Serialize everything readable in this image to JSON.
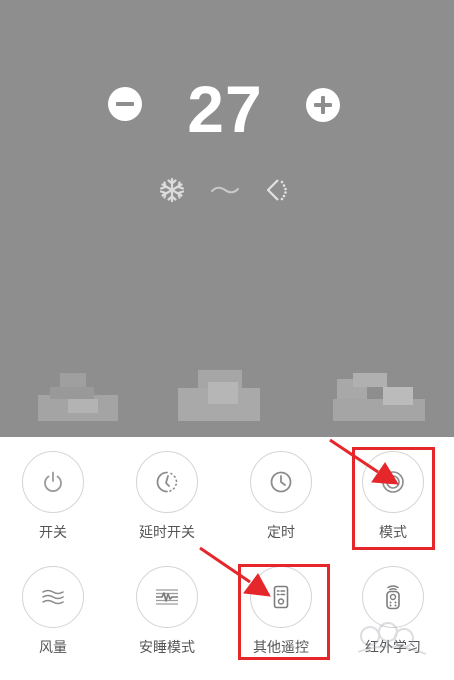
{
  "header": {
    "temperature": "27",
    "decrease_icon": "minus-icon",
    "increase_icon": "plus-icon",
    "status_icons": [
      "snowflake-icon",
      "wave-icon",
      "swing-icon"
    ]
  },
  "controls": [
    {
      "label": "开关",
      "icon": "power-icon"
    },
    {
      "label": "延时开关",
      "icon": "delay-timer-icon"
    },
    {
      "label": "定时",
      "icon": "clock-icon"
    },
    {
      "label": "模式",
      "icon": "mode-icon"
    },
    {
      "label": "风量",
      "icon": "fan-speed-icon"
    },
    {
      "label": "安睡模式",
      "icon": "sleep-mode-icon"
    },
    {
      "label": "其他遥控",
      "icon": "remote-icon"
    },
    {
      "label": "红外学习",
      "icon": "ir-learn-icon"
    }
  ],
  "colors": {
    "panel_bg": "#8e8e8e",
    "annotation": "#e5262b",
    "label": "#555555"
  }
}
